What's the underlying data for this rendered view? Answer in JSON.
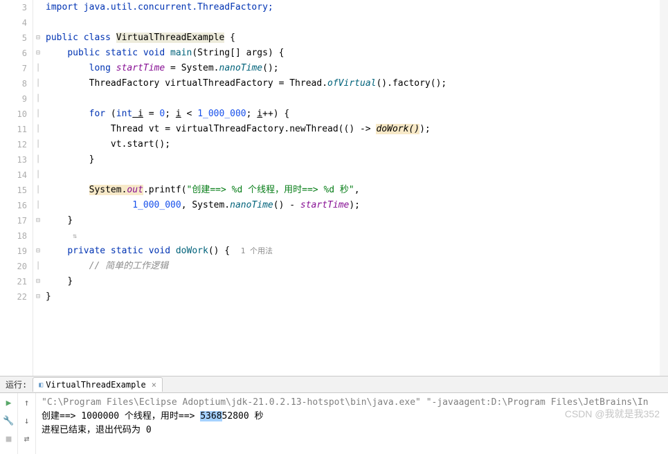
{
  "lines": {
    "3": "import java.util.concurrent.ThreadFactory;",
    "5a": "public",
    "5b": " class ",
    "5c": "VirtualThreadExample",
    "5d": " {",
    "6a": "public static void",
    "6b": " main",
    "6c": "(String[] ",
    "6d": "args",
    "6e": ") {",
    "7a": "long",
    "7b": " startTime",
    "7c": " = System.",
    "7d": "nanoTime",
    "7e": "();",
    "8a": "ThreadFactory ",
    "8b": "virtualThreadFactory",
    "8c": " = Thread.",
    "8d": "ofVirtual",
    "8e": "().factory();",
    "10a": "for",
    "10b": " (",
    "10c": "int",
    "10d": " i",
    "10e": " = ",
    "10f": "0",
    "10g": "; ",
    "10h": "i",
    "10i": " < ",
    "10j": "1_000_000",
    "10k": "; ",
    "10l": "i",
    "10m": "++) {",
    "11a": "Thread ",
    "11b": "vt",
    "11c": " = ",
    "11d": "virtualThreadFactory",
    "11e": ".newThread(() -> ",
    "11f": "doWork()",
    "11g": ");",
    "12a": "vt",
    "12b": ".start();",
    "13": "}",
    "15a": "System.",
    "15b": "out",
    "15c": ".printf(",
    "15d": "\"创建==> %d 个线程，用时==> %d 秒\"",
    "15e": ",",
    "16a": "1_000_000",
    "16b": ", System.",
    "16c": "nanoTime",
    "16d": "() - ",
    "16e": "startTime",
    "16f": ");",
    "17": "}",
    "19a": "private static void",
    "19b": " doWork",
    "19c": "() {  ",
    "19u": "1 个用法",
    "20": "// 简单的工作逻辑",
    "21": "}",
    "22": "}"
  },
  "gutter": {
    "3": "3",
    "4": "4",
    "5": "5",
    "6": "6",
    "7": "7",
    "8": "8",
    "9": "9",
    "10": "10",
    "11": "11",
    "12": "12",
    "13": "13",
    "14": "14",
    "15": "15",
    "16": "16",
    "17": "17",
    "18": "18",
    "19": "19",
    "20": "20",
    "21": "21",
    "22": "22"
  },
  "run": {
    "label": "运行:",
    "tab": "VirtualThreadExample",
    "cmd": "\"C:\\Program Files\\Eclipse Adoptium\\jdk-21.0.2.13-hotspot\\bin\\java.exe\" \"-javaagent:D:\\Program Files\\JetBrains\\In",
    "out1a": "创建==> 1000000 个线程，用时==> ",
    "out1sel": "5368",
    "out1b": "52800 秒",
    "out2": "进程已结束，退出代码为 0"
  },
  "watermark": "CSDN @我就是我352"
}
